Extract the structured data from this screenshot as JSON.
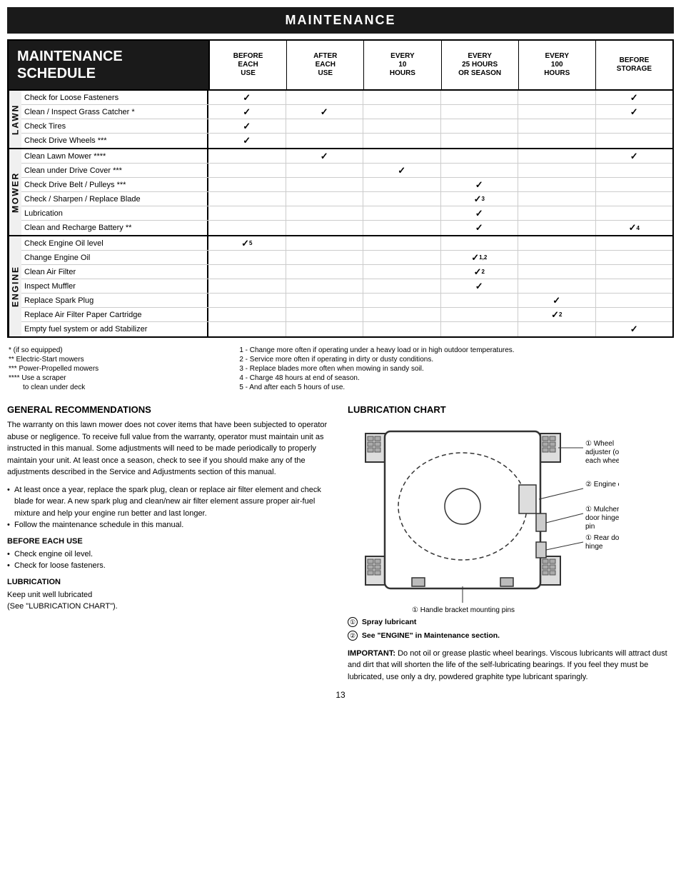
{
  "page": {
    "title": "MAINTENANCE",
    "page_number": "13"
  },
  "schedule": {
    "header_title_line1": "MAINTENANCE",
    "header_title_line2": "SCHEDULE",
    "columns": [
      {
        "id": "before_each_use",
        "line1": "BEFORE",
        "line2": "EACH",
        "line3": "USE"
      },
      {
        "id": "after_each_use",
        "line1": "AFTER",
        "line2": "EACH",
        "line3": "USE"
      },
      {
        "id": "every_10_hours",
        "line1": "EVERY",
        "line2": "10",
        "line3": "HOURS"
      },
      {
        "id": "every_25_hours",
        "line1": "EVERY",
        "line2": "25 HOURS",
        "line3": "OR SEASON"
      },
      {
        "id": "every_100_hours",
        "line1": "EVERY",
        "line2": "100",
        "line3": "HOURS"
      },
      {
        "id": "before_storage",
        "line1": "BEFORE",
        "line2": "STORAGE",
        "line3": ""
      }
    ],
    "sections": [
      {
        "label": "LAWN",
        "rows": [
          {
            "task": "Check for Loose Fasteners",
            "checks": [
              "✓",
              "",
              "",
              "",
              "",
              "✓"
            ]
          },
          {
            "task": "Clean / Inspect Grass Catcher *",
            "checks": [
              "✓",
              "✓",
              "",
              "",
              "",
              "✓"
            ]
          },
          {
            "task": "Check Tires",
            "checks": [
              "✓",
              "",
              "",
              "",
              "",
              ""
            ]
          },
          {
            "task": "Check Drive Wheels ***",
            "checks": [
              "✓",
              "",
              "",
              "",
              "",
              ""
            ]
          }
        ]
      },
      {
        "label": "MOWER",
        "rows": [
          {
            "task": "Clean Lawn Mower ****",
            "checks": [
              "",
              "✓",
              "",
              "",
              "",
              "✓"
            ]
          },
          {
            "task": "Clean under Drive Cover ***",
            "checks": [
              "",
              "",
              "✓",
              "",
              "",
              ""
            ]
          },
          {
            "task": "Check Drive Belt / Pulleys ***",
            "checks": [
              "",
              "",
              "",
              "✓",
              "",
              ""
            ]
          },
          {
            "task": "Check / Sharpen / Replace Blade",
            "checks": [
              "",
              "",
              "",
              "✓₃",
              "",
              ""
            ]
          },
          {
            "task": "Lubrication",
            "checks": [
              "",
              "",
              "",
              "✓",
              "",
              ""
            ]
          },
          {
            "task": "Clean and Recharge Battery **",
            "checks": [
              "",
              "",
              "",
              "✓",
              "",
              "✓₄"
            ]
          }
        ]
      },
      {
        "label": "ENGINE",
        "rows": [
          {
            "task": "Check Engine Oil level",
            "checks": [
              "✓₅",
              "",
              "",
              "",
              "",
              ""
            ]
          },
          {
            "task": "Change Engine Oil",
            "checks": [
              "",
              "",
              "",
              "✓₁,₂",
              "",
              ""
            ]
          },
          {
            "task": "Clean Air Filter",
            "checks": [
              "",
              "",
              "",
              "✓₂",
              "",
              ""
            ]
          },
          {
            "task": "Inspect Muffler",
            "checks": [
              "",
              "",
              "",
              "✓",
              "",
              ""
            ]
          },
          {
            "task": "Replace Spark Plug",
            "checks": [
              "",
              "",
              "",
              "",
              "✓",
              ""
            ]
          },
          {
            "task": "Replace Air Filter Paper Cartridge",
            "checks": [
              "",
              "",
              "",
              "",
              "✓₂",
              ""
            ]
          },
          {
            "task": "Empty fuel system or add Stabilizer",
            "checks": [
              "",
              "",
              "",
              "",
              "",
              "✓"
            ]
          }
        ]
      }
    ]
  },
  "footnotes": {
    "left": [
      "* (if so equipped)",
      "** Electric-Start mowers",
      "*** Power-Propelled mowers",
      "**** Use a scraper",
      "     to clean under deck"
    ],
    "right": [
      "1 - Change more often if operating under a heavy load or in high outdoor temperatures.",
      "2 - Service more often if operating in dirty or dusty conditions.",
      "3 - Replace blades more often when mowing in sandy soil.",
      "4 - Charge 48 hours at end of season.",
      "5 - And after each 5 hours of use."
    ]
  },
  "general_recommendations": {
    "heading": "GENERAL RECOMMENDATIONS",
    "body": "The warranty on this lawn mower does not cover items that have been subjected to operator abuse or negligence.  To receive full value from the warranty, operator must maintain unit as instructed in this manual.  Some adjustments will need to be made periodically to properly maintain your unit.  At least once a season, check to see if you should make any of the adjustments described in the Service and Adjustments section of this manual.",
    "bullets": [
      "At least once a year, replace the spark plug, clean or replace air filter element and check blade for wear.  A new spark plug and clean/new air filter element assure proper air-fuel mixture and help your engine run better and last longer.",
      "Follow the maintenance schedule in this manual."
    ],
    "before_each_use": {
      "heading": "BEFORE EACH USE",
      "bullets": [
        "Check engine oil level.",
        "Check for loose fasteners."
      ]
    },
    "lubrication": {
      "heading": "LUBRICATION",
      "body": "Keep unit well lubricated\n(See \"LUBRICATION CHART\")."
    }
  },
  "lubrication_chart": {
    "heading": "LUBRICATION CHART",
    "labels": [
      {
        "num": "①",
        "text": "Wheel adjuster (on each wheel)"
      },
      {
        "num": "②",
        "text": "Engine oil"
      },
      {
        "num": "①",
        "text": "Mulcher door hinge pin"
      },
      {
        "num": "①",
        "text": "Rear door hinge"
      },
      {
        "num": "①",
        "text": "Handle bracket mounting pins"
      }
    ],
    "legend": [
      {
        "num": "①",
        "text": "Spray lubricant"
      },
      {
        "num": "②",
        "text": "See \"ENGINE\" in Maintenance section."
      }
    ],
    "important": "IMPORTANT:  Do not oil or grease plastic wheel bearings.  Viscous lubricants will attract dust and dirt that will shorten the life of the self-lubricating bearings.  If you feel they must be lubricated, use only a dry, powdered graphite type lubricant sparingly."
  }
}
